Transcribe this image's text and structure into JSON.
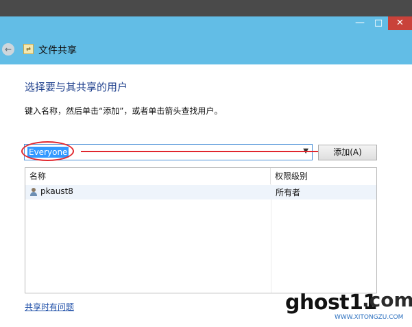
{
  "window": {
    "title": "文件共享",
    "minimize_glyph": "—",
    "maximize_glyph": "□",
    "close_glyph": "✕",
    "back_glyph": "←",
    "app_icon": "share-folder-icon"
  },
  "main": {
    "heading": "选择要与其共享的用户",
    "instruction": "键入名称，然后单击“添加”，或者单击箭头查找用户。",
    "input_value": "Everyone",
    "add_button": "添加(A)",
    "columns": {
      "name": "名称",
      "permission": "权限级别"
    },
    "rows": [
      {
        "name": "pkaust8",
        "permission": "所有者",
        "icon": "user-icon"
      }
    ],
    "help_link": "共享时有问题"
  },
  "colors": {
    "title_bar": "#62bde6",
    "close_button": "#c9423a",
    "heading": "#1e3f8c",
    "annotation": "#e0262e",
    "selection": "#3399ff"
  },
  "watermark": {
    "brand": "ghost11",
    "tld": ".com",
    "site": "WWW.XITONGZU.COM"
  }
}
